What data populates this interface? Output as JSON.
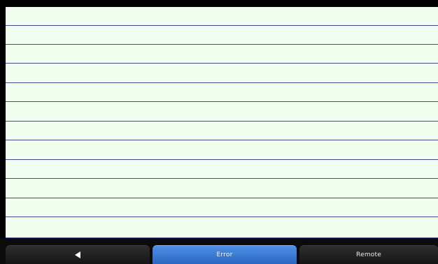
{
  "list": {
    "rows": [
      "",
      "",
      "",
      "",
      "",
      "",
      "",
      "",
      "",
      "",
      "",
      ""
    ]
  },
  "softkeys": {
    "back": {
      "icon": "back-arrow-icon"
    },
    "error": {
      "label": "Error"
    },
    "remote": {
      "label": "Remote"
    }
  },
  "colors": {
    "list_background": "#f1fdef",
    "row_divider": "#3c4f8e",
    "active_button": "#3a7bd5",
    "bar_background": "#0b0b0b"
  }
}
